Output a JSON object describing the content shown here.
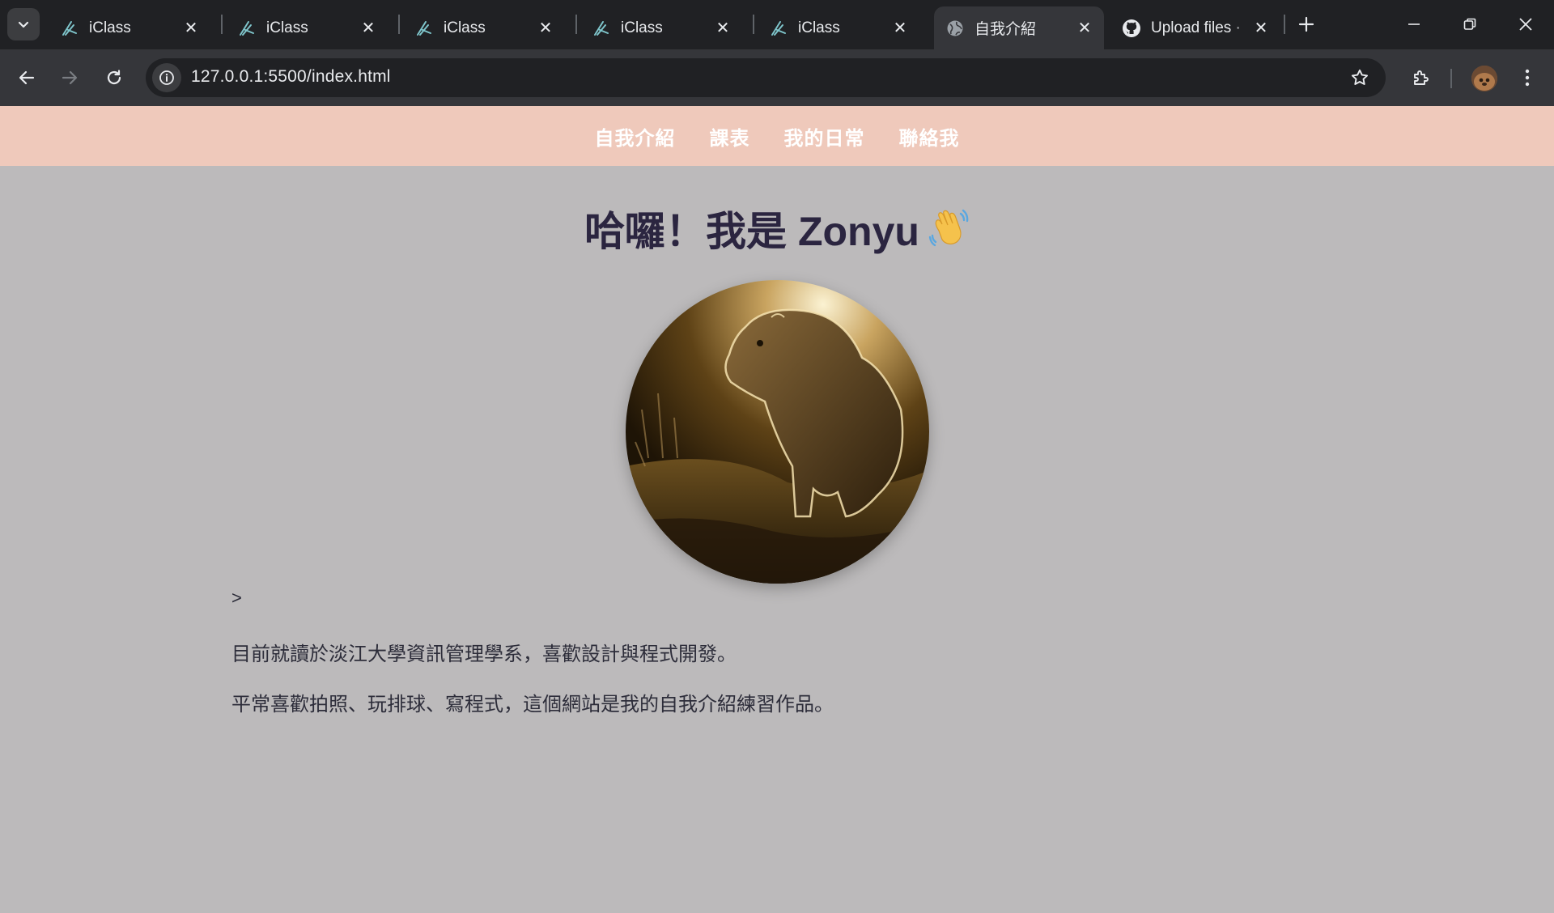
{
  "browser": {
    "tabs": [
      {
        "title": "iClass",
        "favicon": "iclass-icon",
        "active": false
      },
      {
        "title": "iClass",
        "favicon": "iclass-icon",
        "active": false
      },
      {
        "title": "iClass",
        "favicon": "iclass-icon",
        "active": false
      },
      {
        "title": "iClass",
        "favicon": "iclass-icon",
        "active": false
      },
      {
        "title": "iClass",
        "favicon": "iclass-icon",
        "active": false
      },
      {
        "title": "自我介紹",
        "favicon": "globe-icon",
        "active": true
      },
      {
        "title": "Upload files ·",
        "favicon": "github-icon",
        "active": false
      }
    ],
    "url": "127.0.0.1:5500/index.html",
    "colors": {
      "tabbar": "#202124",
      "toolbar": "#35363a",
      "omnibox": "#202124",
      "text": "#e8eaed"
    }
  },
  "site": {
    "nav": {
      "items": [
        "自我介紹",
        "課表",
        "我的日常",
        "聯絡我"
      ],
      "background": "#efc9bb"
    },
    "hero": {
      "title": "哈囉！我是 Zonyu",
      "emoji_icon": "waving-hand-icon"
    },
    "photo": {
      "subject_icon": "capybara-photo"
    },
    "intro": {
      "stray_text": ">",
      "paragraphs": [
        "目前就讀於淡江大學資訊管理學系，喜歡設計與程式開發。",
        "平常喜歡拍照、玩排球、寫程式，這個網站是我的自我介紹練習作品。"
      ]
    },
    "colors": {
      "page_bg": "#bcbabb",
      "heading": "#2b2540",
      "body_text": "#2d2d3a"
    }
  }
}
